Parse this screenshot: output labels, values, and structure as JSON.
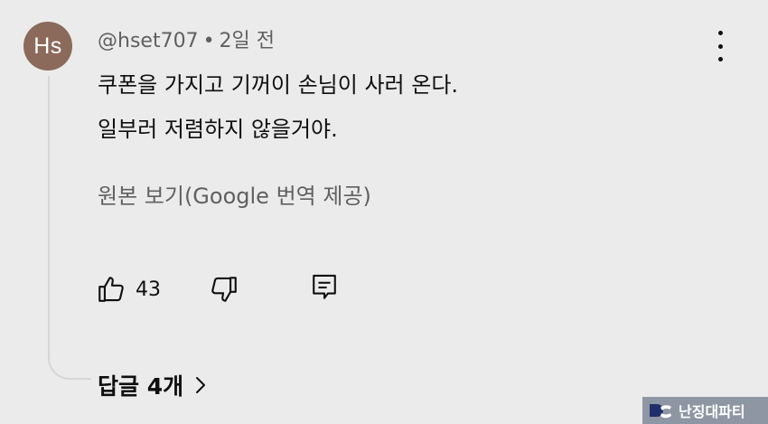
{
  "comment": {
    "avatar_initials": "Hs",
    "avatar_color": "#8b6a5b",
    "author": "@hset707",
    "separator": "•",
    "timestamp": "2일 전",
    "text_lines": [
      "쿠폰을 가지고 기꺼이 손님이 사러 온다.",
      "일부러 저렴하지 않을거야."
    ],
    "translate_label": "원본 보기(Google 번역 제공)",
    "like_count": "43",
    "replies_label": "답글 4개"
  },
  "icons": {
    "menu": "more-vert-icon",
    "like": "thumb-up-icon",
    "dislike": "thumb-down-icon",
    "reply": "comment-icon",
    "expand": "chevron-right-icon"
  },
  "watermark": {
    "text": "난징대파티"
  }
}
